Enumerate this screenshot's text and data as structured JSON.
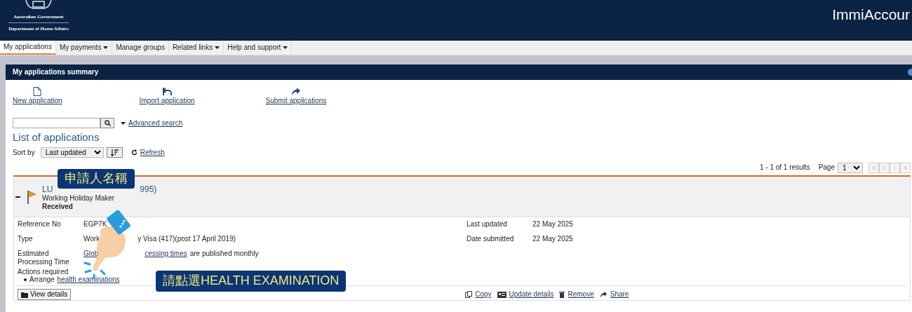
{
  "header": {
    "logo_lines": [
      "Australian Government",
      "Department of Home Affairs"
    ],
    "app_title": "ImmiAccour"
  },
  "nav": [
    {
      "label": "My applications",
      "dropdown": false,
      "selected": true
    },
    {
      "label": "My payments",
      "dropdown": true,
      "selected": false
    },
    {
      "label": "Manage groups",
      "dropdown": false,
      "selected": false
    },
    {
      "label": "Related links",
      "dropdown": true,
      "selected": false
    },
    {
      "label": "Help and support",
      "dropdown": true,
      "selected": false
    }
  ],
  "panel_title": "My applications summary",
  "actions": [
    {
      "label": "New application",
      "kind": "new"
    },
    {
      "label": "Import application",
      "kind": "import"
    },
    {
      "label": "Submit applications",
      "kind": "submit"
    }
  ],
  "advanced_search": "Advanced search",
  "list_title": "List of applications",
  "sort": {
    "label": "Sort by",
    "value": "Last updated"
  },
  "refresh": "Refresh",
  "results": "1 - 1 of 1 results",
  "page_label": "Page",
  "page_value": "1",
  "application": {
    "expanded": true,
    "name_parts": [
      "LU",
      "995)"
    ],
    "subtitle": "Working Holiday Maker",
    "status": "Received",
    "left": [
      {
        "label": "Reference No",
        "parts": [
          {
            "text": "EGP7K",
            "link": false
          }
        ]
      },
      {
        "label": "Type",
        "parts": [
          {
            "text": "Work",
            "link": false
          },
          {
            "text": "y Visa (417)(post 17 April 2019)",
            "link": false
          }
        ]
      },
      {
        "label": "Estimated Processing Time",
        "parts": [
          {
            "text": "Glob",
            "link": true
          },
          {
            "text": "cessing times",
            "link": true
          },
          {
            "text": "are published monthly",
            "link": false
          }
        ]
      }
    ],
    "right": [
      {
        "label": "Last updated",
        "value": "22 May 2025"
      },
      {
        "label": "Date submitted",
        "value": "22 May 2025"
      }
    ],
    "actions_label": "Actions required",
    "action_prefix": "Arrange",
    "action_link": "health examinations",
    "view_details": "View details",
    "footer_links": [
      {
        "label": "Copy",
        "kind": "copy"
      },
      {
        "label": "Update details",
        "kind": "update"
      },
      {
        "label": "Remove",
        "kind": "remove"
      },
      {
        "label": "Share",
        "kind": "share"
      }
    ]
  },
  "annotations": [
    {
      "kind": "name",
      "text": "申請人名稱"
    },
    {
      "kind": "click",
      "text": "請點選HEALTH EXAMINATION"
    }
  ]
}
